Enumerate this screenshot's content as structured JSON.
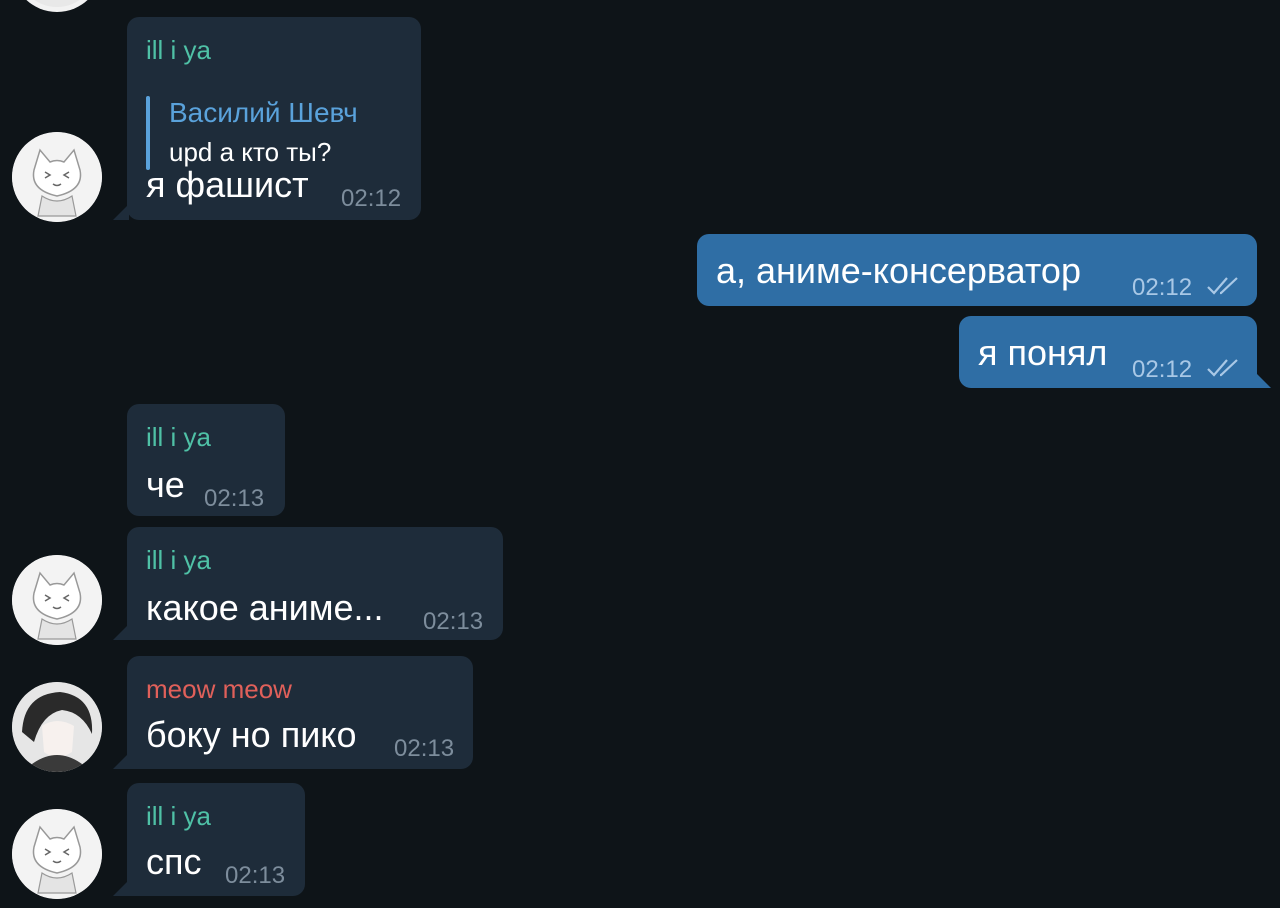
{
  "messages": [
    {
      "sender": "ill i ya",
      "reply": {
        "name": "Василий Шевч",
        "text": "upd а кто ты?"
      },
      "text": "я фашист",
      "time": "02:12"
    },
    {
      "text": "а, аниме-консерватор",
      "time": "02:12",
      "status": "read-double-check-icon"
    },
    {
      "text": "я понял",
      "time": "02:12",
      "status": "read-double-check-icon"
    },
    {
      "sender": "ill i ya",
      "text": "че",
      "time": "02:13"
    },
    {
      "sender": "ill i ya",
      "text": "какое аниме...",
      "time": "02:13"
    },
    {
      "sender": "meow meow",
      "text": "боку но пико",
      "time": "02:13"
    },
    {
      "sender": "ill i ya",
      "text": "спс",
      "time": "02:13"
    }
  ],
  "colors": {
    "background": "#0e1418",
    "incoming_bubble": "#1e2c3a",
    "outgoing_bubble": "#2f6ea5",
    "sender_green": "#4fc1a6",
    "sender_red": "#e0605a",
    "reply_blue": "#5aa2db"
  }
}
